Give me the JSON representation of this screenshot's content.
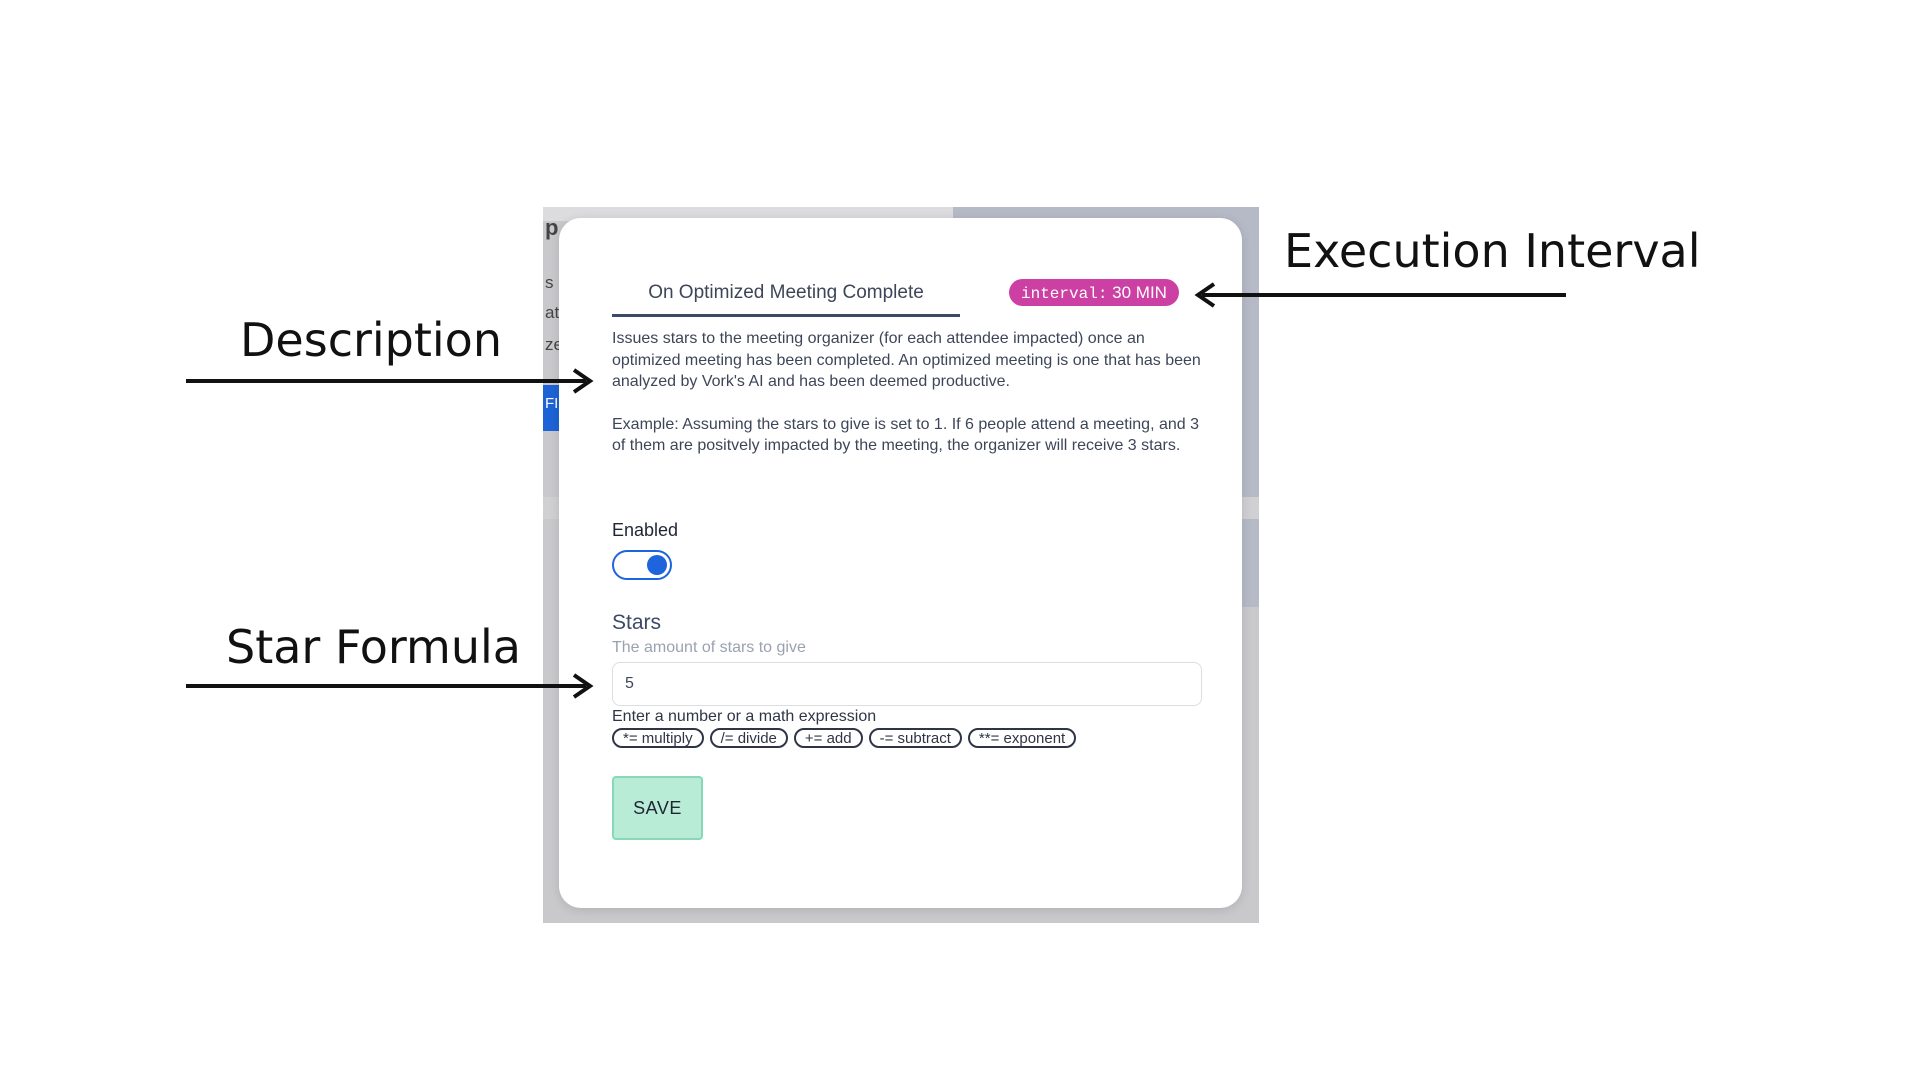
{
  "background": {
    "glyphs": [
      "p",
      "s",
      "at",
      "ze",
      "FI"
    ]
  },
  "modal": {
    "tab_label": "On Optimized Meeting Complete",
    "interval": {
      "key": "interval:",
      "value": "30 MIN"
    },
    "description": {
      "para1": "Issues stars to the meeting organizer (for each attendee impacted) once an optimized meeting has been completed. An optimized meeting is one that has been analyzed by Vork's AI and has been deemed productive.",
      "para2": "Example: Assuming the stars to give is set to 1. If 6 people attend a meeting, and 3 of them are positvely impacted by the meeting, the organizer will receive 3 stars."
    },
    "enabled": {
      "label": "Enabled",
      "value": true
    },
    "stars": {
      "label": "Stars",
      "help": "The amount of stars to give",
      "value": "5",
      "expression_hint": "Enter a number or a math expression",
      "operators": [
        "*= multiply",
        "/= divide",
        "+= add",
        "-= subtract",
        "**= exponent"
      ]
    },
    "save_label": "SAVE"
  },
  "annotations": {
    "execution_interval": "Execution Interval",
    "description": "Description",
    "star_formula": "Star Formula"
  },
  "colors": {
    "accent_blue": "#1e64dc",
    "badge_magenta": "#cc3fa3",
    "save_green": "#b8ecd6"
  }
}
